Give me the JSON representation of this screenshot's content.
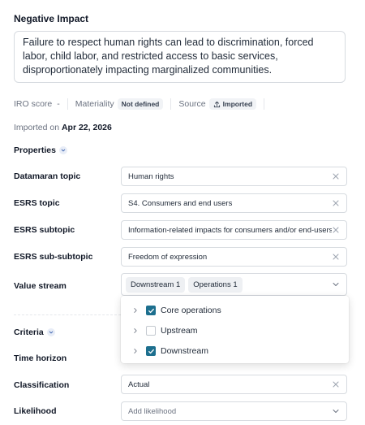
{
  "header": {
    "title": "Negative Impact"
  },
  "description": "Failure to respect human rights can lead to discrimination, forced labor, child labor, and restricted access to basic services, disproportionately impacting marginalized communities.",
  "meta": {
    "iro_label": "IRO score",
    "iro_value": "-",
    "materiality_label": "Materiality",
    "materiality_value": "Not defined",
    "source_label": "Source",
    "source_value": "Imported",
    "source_icon": "upload-icon"
  },
  "imported": {
    "prefix": "Imported on",
    "date": "Apr 22, 2026"
  },
  "properties": {
    "label": "Properties",
    "fields": [
      {
        "label": "Datamaran topic",
        "value": "Human rights"
      },
      {
        "label": "ESRS topic",
        "value": "S4. Consumers and end users"
      },
      {
        "label": "ESRS subtopic",
        "value": "Information-related impacts for consumers and/or end-users"
      },
      {
        "label": "ESRS sub-subtopic",
        "value": "Freedom of expression"
      }
    ],
    "value_stream": {
      "label": "Value stream",
      "tags": [
        "Downstream 1",
        "Operations 1"
      ],
      "options": [
        {
          "label": "Core operations",
          "checked": true
        },
        {
          "label": "Upstream",
          "checked": false
        },
        {
          "label": "Downstream",
          "checked": true
        }
      ]
    }
  },
  "criteria": {
    "label": "Criteria",
    "fields": [
      {
        "label": "Time horizon"
      },
      {
        "label": "Classification",
        "value": "Actual"
      },
      {
        "label": "Likelihood",
        "placeholder": "Add likelihood"
      }
    ]
  },
  "colors": {
    "checkbox": "#1d6f8e",
    "accent_circle": "#e8edf7"
  }
}
